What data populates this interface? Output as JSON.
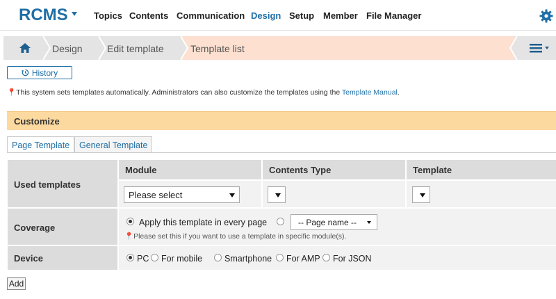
{
  "header": {
    "logo": "RCMS",
    "nav": [
      {
        "label": "Topics"
      },
      {
        "label": "Contents"
      },
      {
        "label": "Communication"
      },
      {
        "label": "Design",
        "active": true
      },
      {
        "label": "Setup"
      },
      {
        "label": "Member"
      },
      {
        "label": "File Manager"
      }
    ],
    "accent_color": "#1f6fa6"
  },
  "breadcrumb": {
    "items": [
      "Design",
      "Edit template",
      "Template list"
    ]
  },
  "history_button": "History",
  "info": {
    "text": "This system sets templates automatically. Administrators can also customize the templates using the ",
    "link": "Template Manual",
    "suffix": "."
  },
  "section_title": "Customize",
  "tabs": [
    {
      "label": "Page Template",
      "active": true
    },
    {
      "label": "General Template",
      "active": false
    }
  ],
  "table": {
    "used_templates": "Used templates",
    "columns": [
      "Module",
      "Contents Type",
      "Template"
    ],
    "module_select": "Please select",
    "coverage": {
      "label": "Coverage",
      "option_all": "Apply this template in every page",
      "page_select": "-- Page name --",
      "note": "Please set this if you want to use a template in specific module(s)."
    },
    "device": {
      "label": "Device",
      "options": [
        "PC",
        "For mobile",
        "Smartphone",
        "For AMP",
        "For JSON"
      ],
      "selected": "PC"
    }
  },
  "add_button": "Add"
}
